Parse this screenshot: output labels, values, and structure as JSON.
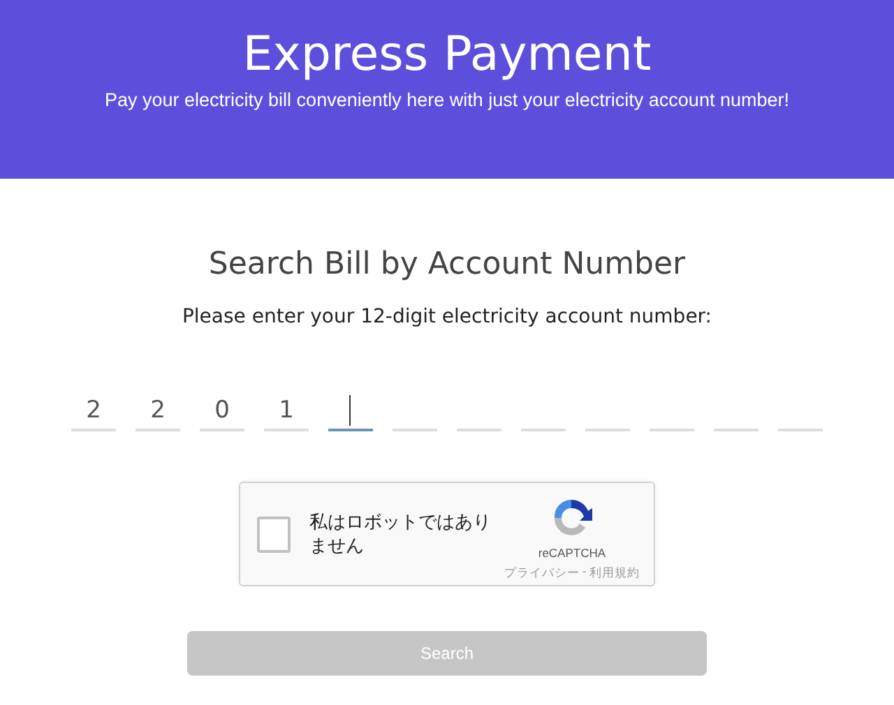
{
  "header": {
    "title": "Express Payment",
    "subtitle": "Pay your electricity bill conveniently here with just your electricity account number!"
  },
  "search": {
    "heading": "Search Bill by Account Number",
    "instruction": "Please enter your 12-digit electricity account number:",
    "digits": [
      {
        "value": "2",
        "focused": false
      },
      {
        "value": "2",
        "focused": false
      },
      {
        "value": "0",
        "focused": false
      },
      {
        "value": "1",
        "focused": false
      },
      {
        "focused": true
      },
      {
        "focused": false
      },
      {
        "focused": false
      },
      {
        "focused": false
      },
      {
        "focused": false
      },
      {
        "focused": false
      },
      {
        "focused": false
      },
      {
        "focused": false
      }
    ]
  },
  "captcha": {
    "label": "私はロボットではありません",
    "checked": false,
    "brand": "reCAPTCHA",
    "privacy": "プライバシー",
    "separator": "-",
    "terms": "利用規約"
  },
  "button": {
    "label": "Search",
    "disabled": true
  }
}
